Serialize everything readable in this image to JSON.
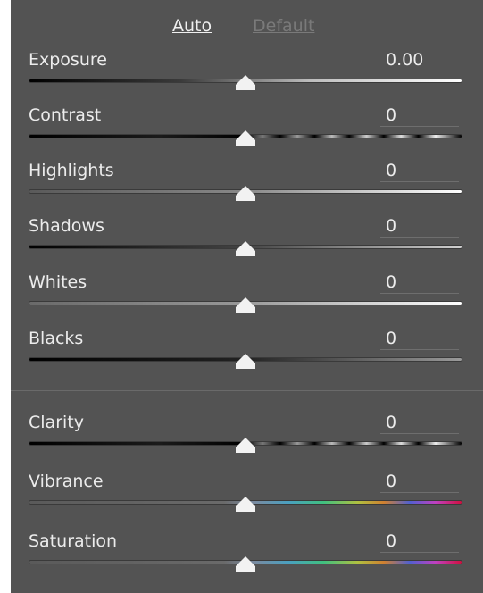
{
  "links": {
    "auto": "Auto",
    "default": "Default"
  },
  "sliders": [
    {
      "label": "Exposure",
      "value": "0.00",
      "position_fraction": 0.5
    },
    {
      "label": "Contrast",
      "value": "0",
      "position_fraction": 0.5
    },
    {
      "label": "Highlights",
      "value": "0",
      "position_fraction": 0.5
    },
    {
      "label": "Shadows",
      "value": "0",
      "position_fraction": 0.5
    },
    {
      "label": "Whites",
      "value": "0",
      "position_fraction": 0.5
    },
    {
      "label": "Blacks",
      "value": "0",
      "position_fraction": 0.5
    },
    {
      "label": "Clarity",
      "value": "0",
      "position_fraction": 0.5
    },
    {
      "label": "Vibrance",
      "value": "0",
      "position_fraction": 0.5
    },
    {
      "label": "Saturation",
      "value": "0",
      "position_fraction": 0.5
    }
  ],
  "colors": {
    "panel_bg": "#535353",
    "thumb": "#f2f2f2"
  }
}
